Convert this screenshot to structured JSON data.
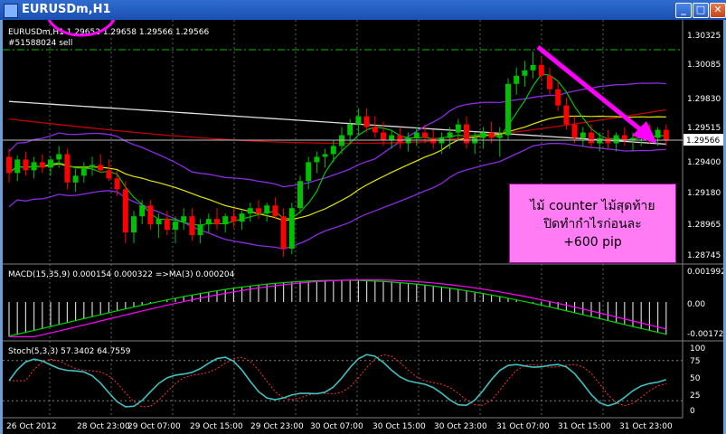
{
  "window": {
    "title": "EURUSDm,H1",
    "buttons": [
      "_",
      "□",
      "✕"
    ]
  },
  "main_panel": {
    "info": "EURUSDm,H1  1.29652 1.29658 1.29566 1.29566",
    "order": "#51588024 sell",
    "price_axis": [
      "1.30325",
      "1.30085",
      "1.29830",
      "1.29515",
      "1.29400",
      "1.29180",
      "1.28965",
      "1.28745"
    ],
    "current_price": "1.29566"
  },
  "macd_panel": {
    "info": "MACD(15,35,9) 0.000154 0.000322  =>MA(3) 0.000204",
    "axis": [
      "0.001992",
      "0.00",
      "-0.00172"
    ]
  },
  "stoch_panel": {
    "info": "Stoch(5,3,3) 57.3402 64.7559",
    "axis": [
      "100",
      "75",
      "50",
      "25",
      "0"
    ]
  },
  "time_axis": [
    "26 Oct 2012",
    "28 Oct 23:00",
    "29 Oct 07:00",
    "29 Oct 15:00",
    "29 Oct 23:00",
    "30 Oct 07:00",
    "30 Oct 15:00",
    "30 Oct 23:00",
    "31 Oct 07:00",
    "31 Oct 15:00",
    "31 Oct 23:00"
  ],
  "annotation": {
    "line1": "ไม้ counter ไม้สุดท้าย",
    "line2": "ปิดทำกำไรก่อนละ",
    "line3": "+600 pip"
  },
  "colors": {
    "bull": "#00c000",
    "bear": "#ff0000",
    "bands": "#8a2be2",
    "ma_slow": "#e0e0e0",
    "ma_red": "#c00000",
    "ma_yellow": "#e6e600",
    "ma_green": "#00d000",
    "macd_signal": "#ff00ff",
    "stoch_main": "#40c0c0",
    "annotation_bg": "#ff7cf5",
    "arrow": "#ff00ff",
    "highlight_circle": "#ff00ff"
  },
  "candles": [
    {
      "o": 1.2944,
      "h": 1.295,
      "l": 1.2925,
      "c": 1.2932
    },
    {
      "o": 1.2932,
      "h": 1.2945,
      "l": 1.2926,
      "c": 1.2942
    },
    {
      "o": 1.2942,
      "h": 1.2948,
      "l": 1.293,
      "c": 1.2934
    },
    {
      "o": 1.2934,
      "h": 1.2944,
      "l": 1.2928,
      "c": 1.294
    },
    {
      "o": 1.294,
      "h": 1.2946,
      "l": 1.2932,
      "c": 1.2936
    },
    {
      "o": 1.2936,
      "h": 1.2944,
      "l": 1.293,
      "c": 1.2942
    },
    {
      "o": 1.2942,
      "h": 1.2952,
      "l": 1.2936,
      "c": 1.2946
    },
    {
      "o": 1.2946,
      "h": 1.295,
      "l": 1.292,
      "c": 1.2925
    },
    {
      "o": 1.2925,
      "h": 1.2935,
      "l": 1.2918,
      "c": 1.293
    },
    {
      "o": 1.293,
      "h": 1.294,
      "l": 1.2925,
      "c": 1.2936
    },
    {
      "o": 1.2936,
      "h": 1.2944,
      "l": 1.293,
      "c": 1.2938
    },
    {
      "o": 1.2938,
      "h": 1.2946,
      "l": 1.2932,
      "c": 1.2934
    },
    {
      "o": 1.2934,
      "h": 1.2942,
      "l": 1.2926,
      "c": 1.2928
    },
    {
      "o": 1.2928,
      "h": 1.2934,
      "l": 1.2915,
      "c": 1.292
    },
    {
      "o": 1.292,
      "h": 1.2926,
      "l": 1.288,
      "c": 1.2888
    },
    {
      "o": 1.2888,
      "h": 1.2904,
      "l": 1.288,
      "c": 1.29
    },
    {
      "o": 1.29,
      "h": 1.2912,
      "l": 1.2894,
      "c": 1.2908
    },
    {
      "o": 1.2908,
      "h": 1.2912,
      "l": 1.289,
      "c": 1.2894
    },
    {
      "o": 1.2894,
      "h": 1.2902,
      "l": 1.2884,
      "c": 1.2898
    },
    {
      "o": 1.2898,
      "h": 1.2904,
      "l": 1.2886,
      "c": 1.289
    },
    {
      "o": 1.289,
      "h": 1.29,
      "l": 1.288,
      "c": 1.2896
    },
    {
      "o": 1.2896,
      "h": 1.2906,
      "l": 1.289,
      "c": 1.29
    },
    {
      "o": 1.29,
      "h": 1.2906,
      "l": 1.2882,
      "c": 1.2886
    },
    {
      "o": 1.2886,
      "h": 1.2898,
      "l": 1.288,
      "c": 1.2894
    },
    {
      "o": 1.2894,
      "h": 1.2902,
      "l": 1.2888,
      "c": 1.2898
    },
    {
      "o": 1.2898,
      "h": 1.2906,
      "l": 1.289,
      "c": 1.2894
    },
    {
      "o": 1.2894,
      "h": 1.2902,
      "l": 1.2888,
      "c": 1.29
    },
    {
      "o": 1.29,
      "h": 1.2906,
      "l": 1.2892,
      "c": 1.2896
    },
    {
      "o": 1.2896,
      "h": 1.2904,
      "l": 1.289,
      "c": 1.2902
    },
    {
      "o": 1.2902,
      "h": 1.291,
      "l": 1.2896,
      "c": 1.2906
    },
    {
      "o": 1.2906,
      "h": 1.2912,
      "l": 1.2898,
      "c": 1.2902
    },
    {
      "o": 1.2902,
      "h": 1.291,
      "l": 1.2896,
      "c": 1.2908
    },
    {
      "o": 1.2908,
      "h": 1.2914,
      "l": 1.2898,
      "c": 1.29
    },
    {
      "o": 1.29,
      "h": 1.2906,
      "l": 1.287,
      "c": 1.2876
    },
    {
      "o": 1.2876,
      "h": 1.291,
      "l": 1.2872,
      "c": 1.2906
    },
    {
      "o": 1.2906,
      "h": 1.293,
      "l": 1.2902,
      "c": 1.2926
    },
    {
      "o": 1.2926,
      "h": 1.2944,
      "l": 1.292,
      "c": 1.294
    },
    {
      "o": 1.294,
      "h": 1.2948,
      "l": 1.2932,
      "c": 1.2944
    },
    {
      "o": 1.2944,
      "h": 1.295,
      "l": 1.2936,
      "c": 1.2946
    },
    {
      "o": 1.2946,
      "h": 1.2956,
      "l": 1.294,
      "c": 1.2952
    },
    {
      "o": 1.2952,
      "h": 1.2966,
      "l": 1.2946,
      "c": 1.296
    },
    {
      "o": 1.296,
      "h": 1.2972,
      "l": 1.2954,
      "c": 1.2968
    },
    {
      "o": 1.2968,
      "h": 1.298,
      "l": 1.296,
      "c": 1.2974
    },
    {
      "o": 1.2974,
      "h": 1.298,
      "l": 1.2962,
      "c": 1.2966
    },
    {
      "o": 1.2966,
      "h": 1.2974,
      "l": 1.2958,
      "c": 1.2962
    },
    {
      "o": 1.2962,
      "h": 1.297,
      "l": 1.2952,
      "c": 1.2956
    },
    {
      "o": 1.2956,
      "h": 1.2964,
      "l": 1.295,
      "c": 1.296
    },
    {
      "o": 1.296,
      "h": 1.2966,
      "l": 1.295,
      "c": 1.2954
    },
    {
      "o": 1.2954,
      "h": 1.2962,
      "l": 1.2948,
      "c": 1.2958
    },
    {
      "o": 1.2958,
      "h": 1.2966,
      "l": 1.2952,
      "c": 1.2962
    },
    {
      "o": 1.2962,
      "h": 1.2968,
      "l": 1.2954,
      "c": 1.2958
    },
    {
      "o": 1.2958,
      "h": 1.2964,
      "l": 1.295,
      "c": 1.2954
    },
    {
      "o": 1.2954,
      "h": 1.2962,
      "l": 1.2946,
      "c": 1.2958
    },
    {
      "o": 1.2958,
      "h": 1.2966,
      "l": 1.295,
      "c": 1.2962
    },
    {
      "o": 1.2962,
      "h": 1.2972,
      "l": 1.2956,
      "c": 1.2968
    },
    {
      "o": 1.2968,
      "h": 1.2974,
      "l": 1.295,
      "c": 1.2954
    },
    {
      "o": 1.2954,
      "h": 1.2962,
      "l": 1.2946,
      "c": 1.2958
    },
    {
      "o": 1.2958,
      "h": 1.2966,
      "l": 1.295,
      "c": 1.2962
    },
    {
      "o": 1.2962,
      "h": 1.297,
      "l": 1.2954,
      "c": 1.2958
    },
    {
      "o": 1.2958,
      "h": 1.2966,
      "l": 1.2944,
      "c": 1.296
    },
    {
      "o": 1.296,
      "h": 1.3002,
      "l": 1.2956,
      "c": 1.2998
    },
    {
      "o": 1.2998,
      "h": 1.301,
      "l": 1.299,
      "c": 1.3004
    },
    {
      "o": 1.3004,
      "h": 1.3015,
      "l": 1.2996,
      "c": 1.3008
    },
    {
      "o": 1.3008,
      "h": 1.3022,
      "l": 1.3002,
      "c": 1.3012
    },
    {
      "o": 1.3012,
      "h": 1.3018,
      "l": 1.3,
      "c": 1.3004
    },
    {
      "o": 1.3004,
      "h": 1.301,
      "l": 1.299,
      "c": 1.2994
    },
    {
      "o": 1.2994,
      "h": 1.3,
      "l": 1.2978,
      "c": 1.2982
    },
    {
      "o": 1.2982,
      "h": 1.2988,
      "l": 1.2964,
      "c": 1.2968
    },
    {
      "o": 1.2968,
      "h": 1.2974,
      "l": 1.2954,
      "c": 1.2958
    },
    {
      "o": 1.2958,
      "h": 1.2966,
      "l": 1.2952,
      "c": 1.2962
    },
    {
      "o": 1.2962,
      "h": 1.2968,
      "l": 1.295,
      "c": 1.2954
    },
    {
      "o": 1.2954,
      "h": 1.2962,
      "l": 1.2948,
      "c": 1.2958
    },
    {
      "o": 1.2958,
      "h": 1.2964,
      "l": 1.295,
      "c": 1.2954
    },
    {
      "o": 1.2954,
      "h": 1.2962,
      "l": 1.2948,
      "c": 1.296
    },
    {
      "o": 1.296,
      "h": 1.2966,
      "l": 1.2952,
      "c": 1.2956
    },
    {
      "o": 1.2956,
      "h": 1.2962,
      "l": 1.2948,
      "c": 1.2958
    },
    {
      "o": 1.2958,
      "h": 1.2966,
      "l": 1.2952,
      "c": 1.2962
    },
    {
      "o": 1.2962,
      "h": 1.2968,
      "l": 1.2954,
      "c": 1.2958
    },
    {
      "o": 1.2958,
      "h": 1.2966,
      "l": 1.2952,
      "c": 1.2964
    },
    {
      "o": 1.2964,
      "h": 1.2968,
      "l": 1.2952,
      "c": 1.2956
    }
  ]
}
